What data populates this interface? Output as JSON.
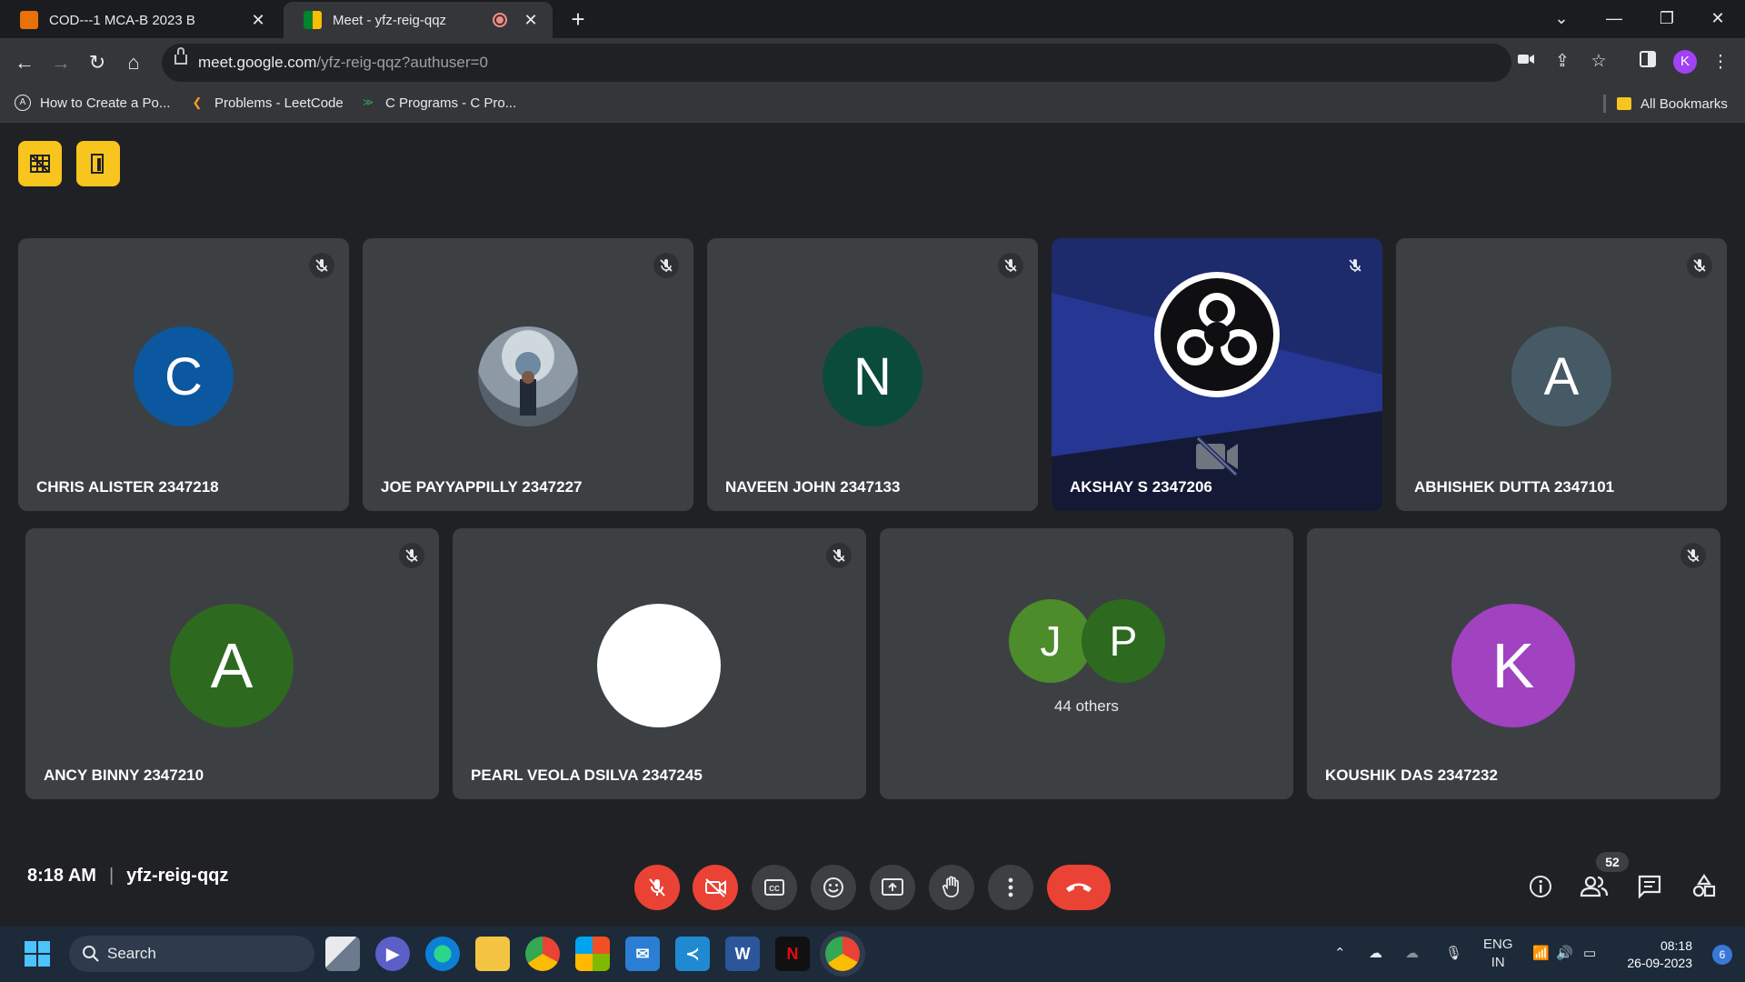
{
  "browser": {
    "tabs": [
      {
        "title": "COD---1 MCA-B 2023 B",
        "favicon_color": "#e8710a"
      },
      {
        "title": "Meet - yfz-reig-qqz",
        "favicon_color": "#00832d"
      }
    ],
    "new_tab_label": "+",
    "url_host": "meet.google.com",
    "url_path": "/yfz-reig-qqz?authuser=0",
    "profile_initial": "K",
    "bookmarks": [
      {
        "label": "How to Create a Po..."
      },
      {
        "label": "Problems - LeetCode"
      },
      {
        "label": "C Programs - C Pro..."
      }
    ],
    "all_bookmarks_label": "All Bookmarks"
  },
  "meet": {
    "participants_row1": [
      {
        "name": "CHRIS ALISTER 2347218",
        "initial": "C",
        "avatar_color": "#0b57a0",
        "muted": true
      },
      {
        "name": "JOE PAYYAPPILLY 2347227",
        "initial": "",
        "avatar_color": "#8d9aa6",
        "muted": true
      },
      {
        "name": "NAVEEN JOHN 2347133",
        "initial": "N",
        "avatar_color": "#0a4b3c",
        "muted": true
      },
      {
        "name": "AKSHAY S 2347206",
        "initial": "",
        "avatar_color": "#0f0f12",
        "muted": true
      },
      {
        "name": "ABHISHEK DUTTA 2347101",
        "initial": "A",
        "avatar_color": "#455a64",
        "muted": true
      }
    ],
    "participants_row2": [
      {
        "name": "ANCY BINNY 2347210",
        "initial": "A",
        "avatar_color": "#2d6a1f",
        "muted": true
      },
      {
        "name": "PEARL VEOLA DSILVA 2347245",
        "initial": "",
        "avatar_color": "#ffffff",
        "muted": true
      },
      {
        "name": "KOUSHIK DAS 2347232",
        "initial": "K",
        "avatar_color": "#a142c0",
        "muted": true
      }
    ],
    "others_tile": {
      "initials": [
        "J",
        "P"
      ],
      "colors": [
        "#4c8c2b",
        "#2d6a1f"
      ],
      "label": "44 others"
    },
    "time": "8:18 AM",
    "meeting_code": "yfz-reig-qqz",
    "participant_count": "52"
  },
  "taskbar": {
    "search_label": "Search",
    "lang": "ENG",
    "region": "IN",
    "time": "08:18",
    "date": "26-09-2023",
    "notification_count": "6"
  }
}
